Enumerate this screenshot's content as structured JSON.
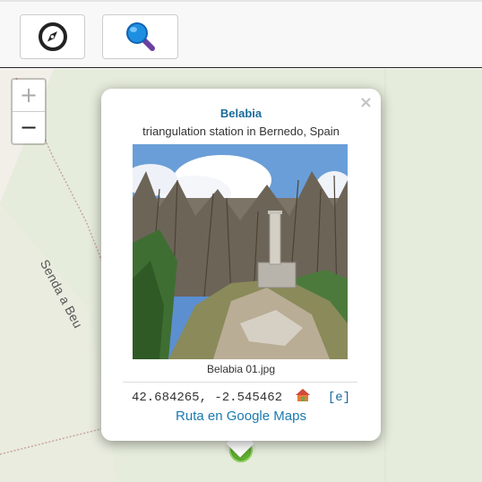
{
  "toolbar": {
    "buttons": [
      {
        "icon": "compass-icon",
        "color": "#222222"
      },
      {
        "icon": "search-icon",
        "color": "#1e8fe0"
      }
    ]
  },
  "map": {
    "road_label": "Senda a Beu",
    "colors": {
      "land": "#f2efe9",
      "forest": "#e6ecdc",
      "path": "#c9a59c"
    }
  },
  "zoom": {
    "in_label": "+",
    "out_label": "−"
  },
  "popup": {
    "close_label": "×",
    "title": "Belabia",
    "description": "triangulation station in Bernedo, Spain",
    "image_caption": "Belabia 01.jpg",
    "coordinates": "42.684265, -2.545462",
    "home_icon": "home-icon",
    "edit_label": "[e]",
    "link_label": "Ruta en Google Maps"
  },
  "marker": {
    "color": "#6bbf3b"
  }
}
